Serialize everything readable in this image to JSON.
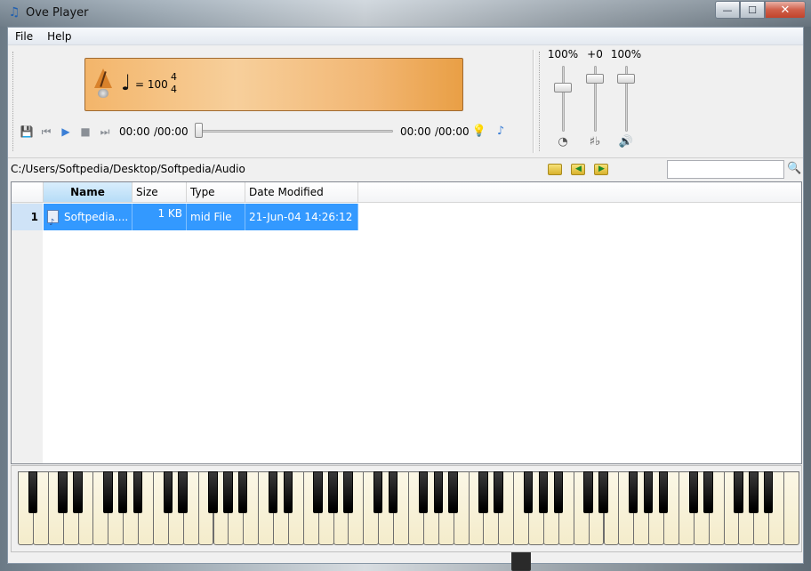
{
  "window": {
    "title": "Ove Player",
    "minimize": "—",
    "maximize": "☐",
    "close": "✕"
  },
  "menu": [
    {
      "label": "File"
    },
    {
      "label": "Help"
    }
  ],
  "display": {
    "tempo_prefix": "= 100",
    "timesig_top": "4",
    "timesig_bottom": "4"
  },
  "transport": {
    "elapsed": "00:00",
    "total": "/00:00",
    "elapsed_right": "00:00",
    "total_right": "/00:00",
    "progress_percent": 0
  },
  "mixer": [
    {
      "label": "100%",
      "icon": "◔",
      "level_fraction": 0.3
    },
    {
      "label": "+0",
      "icon": "♯♭",
      "level_fraction": 0.15
    },
    {
      "label": "100%",
      "icon": "🔊",
      "level_fraction": 0.15
    }
  ],
  "path": "C:/Users/Softpedia/Desktop/Softpedia/Audio",
  "search": {
    "value": "",
    "placeholder": ""
  },
  "table": {
    "headers": [
      "Name",
      "Size",
      "Type",
      "Date Modified"
    ],
    "rows": [
      {
        "num": "1",
        "name": "Softpedia....",
        "size": "1 KB",
        "type": "mid File",
        "modified": "21-Jun-04 14:26:12"
      }
    ]
  },
  "colors": {
    "selection": "#3399ff",
    "display_orange": "#f3b56a"
  },
  "icons": {
    "window": "music-note-icon",
    "save": "save-icon",
    "prev": "previous-icon",
    "play": "play-icon",
    "stop": "stop-icon",
    "next": "next-icon",
    "hint": "lightbulb-icon",
    "note_tool": "note-edit-icon",
    "piano_toggle": "piano-keyboard-icon",
    "metronome": "metronome-icon"
  }
}
